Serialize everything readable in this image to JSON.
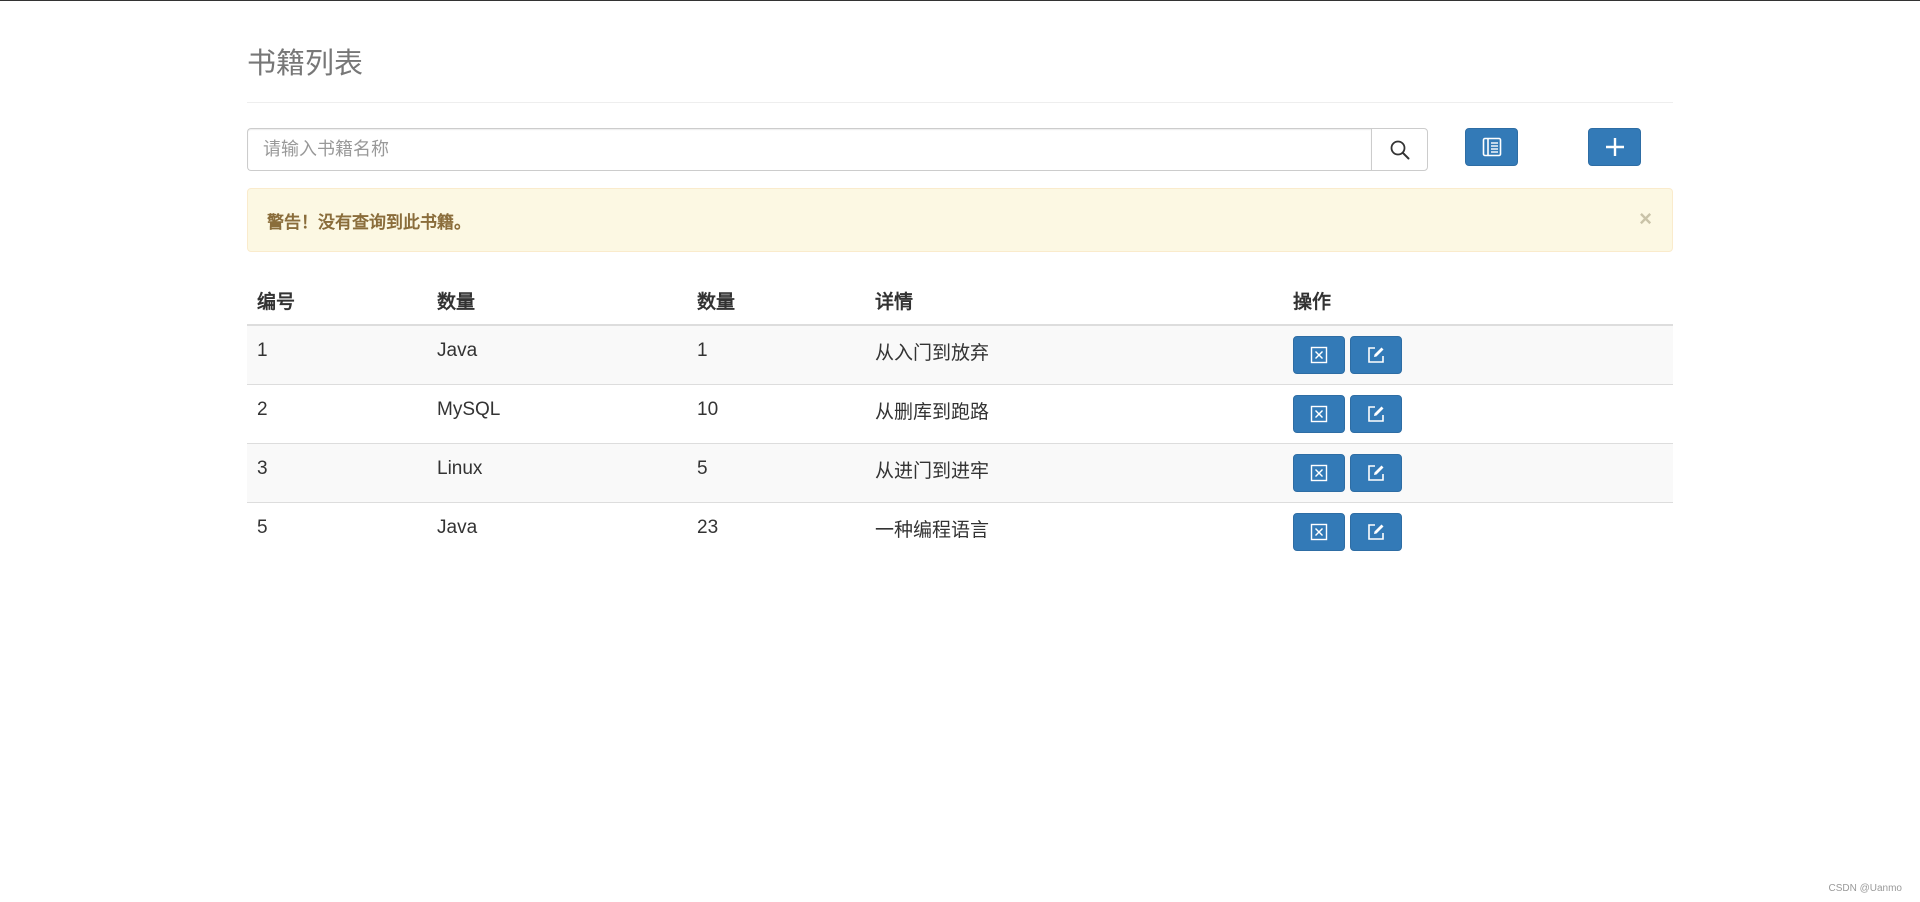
{
  "page": {
    "title": "书籍列表"
  },
  "search": {
    "placeholder": "请输入书籍名称",
    "value": "",
    "search_icon": "search-icon"
  },
  "toolbar": {
    "list_icon": "list-icon",
    "add_icon": "plus-icon"
  },
  "alert": {
    "message": "警告！没有查询到此书籍。",
    "close_label": "×"
  },
  "table": {
    "headers": [
      "编号",
      "数量",
      "数量",
      "详情",
      "操作"
    ],
    "rows": [
      {
        "id": "1",
        "name": "Java",
        "count": "1",
        "detail": "从入门到放弃"
      },
      {
        "id": "2",
        "name": "MySQL",
        "count": "10",
        "detail": "从删库到跑路"
      },
      {
        "id": "3",
        "name": "Linux",
        "count": "5",
        "detail": "从进门到进牢"
      },
      {
        "id": "5",
        "name": "Java",
        "count": "23",
        "detail": "一种编程语言"
      }
    ],
    "row_actions": [
      "delete-icon",
      "edit-icon"
    ]
  },
  "watermark": "CSDN @Uanmo",
  "colors": {
    "primary": "#337ab7",
    "alert_bg": "#fcf8e3",
    "alert_text": "#8a6d3b"
  }
}
